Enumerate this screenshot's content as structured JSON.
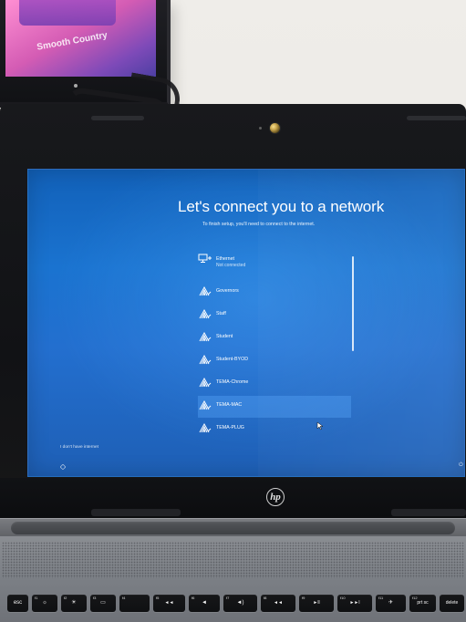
{
  "background_monitor": {
    "brand_text": "Smooth Country"
  },
  "laptop": {
    "brand_logo": "hp",
    "screen": {
      "title": "Let's connect you to a network",
      "subtitle": "To finish setup, you'll need to connect to the internet.",
      "networks": [
        {
          "name": "Ethernet",
          "status": "Not connected",
          "icon": "ethernet-icon",
          "selected": false
        },
        {
          "name": "Governors",
          "status": "",
          "icon": "wifi-icon",
          "selected": false
        },
        {
          "name": "Staff",
          "status": "",
          "icon": "wifi-icon",
          "selected": false
        },
        {
          "name": "Student",
          "status": "",
          "icon": "wifi-icon",
          "selected": false
        },
        {
          "name": "Student-BYOD",
          "status": "",
          "icon": "wifi-icon",
          "selected": false
        },
        {
          "name": "TEMA-Chrome",
          "status": "",
          "icon": "wifi-icon",
          "selected": false
        },
        {
          "name": "TEMA-MAC",
          "status": "",
          "icon": "wifi-icon",
          "selected": true
        },
        {
          "name": "TEMA-PLUG",
          "status": "",
          "icon": "wifi-icon",
          "selected": false
        }
      ],
      "footer_link": "I don't have internet"
    },
    "keyboard": {
      "keys": [
        {
          "small": "",
          "main": "esc"
        },
        {
          "small": "f1",
          "main": "☼"
        },
        {
          "small": "f2",
          "main": "☀"
        },
        {
          "small": "f3",
          "main": "▭"
        },
        {
          "small": "f4",
          "main": ""
        },
        {
          "small": "f5",
          "main": "◄◄"
        },
        {
          "small": "f6",
          "main": "◄"
        },
        {
          "small": "f7",
          "main": "◄)"
        },
        {
          "small": "f8",
          "main": "◄◄"
        },
        {
          "small": "f9",
          "main": "►ll"
        },
        {
          "small": "f10",
          "main": "►►l"
        },
        {
          "small": "f11",
          "main": "✈"
        },
        {
          "small": "f12",
          "main": "prt sc"
        },
        {
          "small": "",
          "main": "delete"
        }
      ]
    }
  },
  "colors": {
    "screen_blue": "#1a73d0",
    "selection_blue": "#5fadff",
    "bezel": "#111215",
    "keyboard_deck": "#7c8086"
  }
}
